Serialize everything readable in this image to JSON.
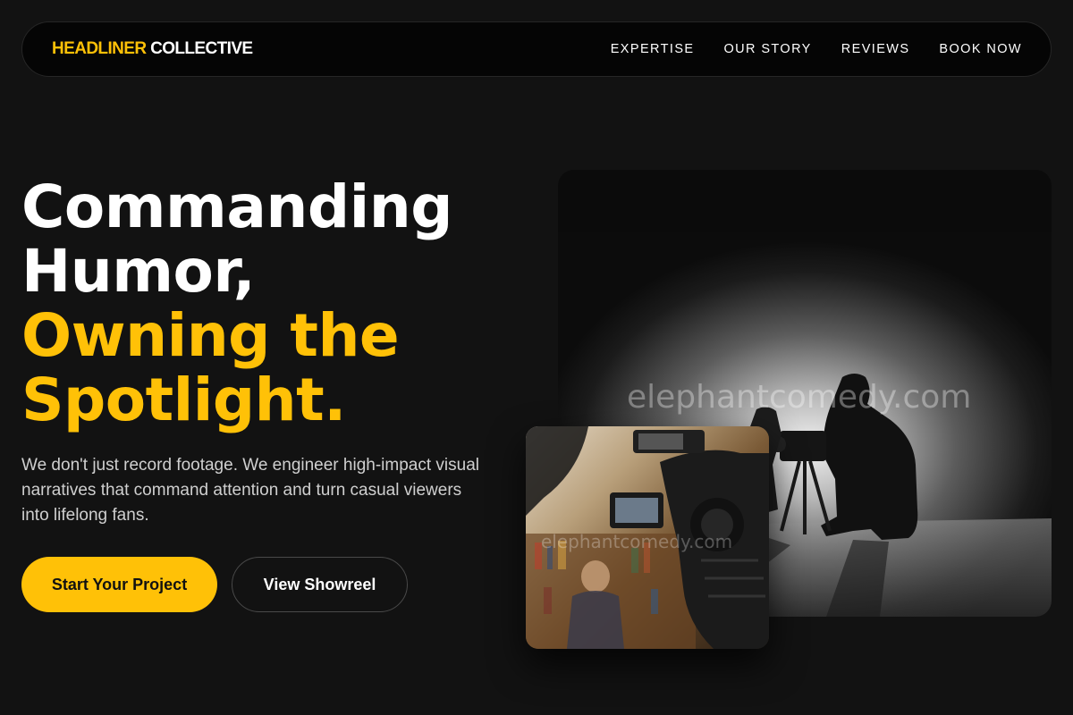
{
  "nav": {
    "logo_accent": "HEADLINER",
    "logo_rest": "COLLECTIVE",
    "links": [
      "EXPERTISE",
      "OUR STORY",
      "REVIEWS",
      "BOOK NOW"
    ]
  },
  "hero": {
    "title_line1": "Commanding",
    "title_line2": "Humor,",
    "title_line3": "Owning the",
    "title_line4": "Spotlight.",
    "subtitle": "We don't just record footage. We engineer high-impact visual narratives that command attention and turn casual viewers into lifelong fans.",
    "primary_cta": "Start Your Project",
    "secondary_cta": "View Showreel"
  },
  "images": {
    "watermark_main": "elephantcomedy.com",
    "watermark_small": "elephantcomedy.com"
  },
  "colors": {
    "accent": "#ffc107",
    "background": "#121212",
    "nav_background": "#050505"
  }
}
